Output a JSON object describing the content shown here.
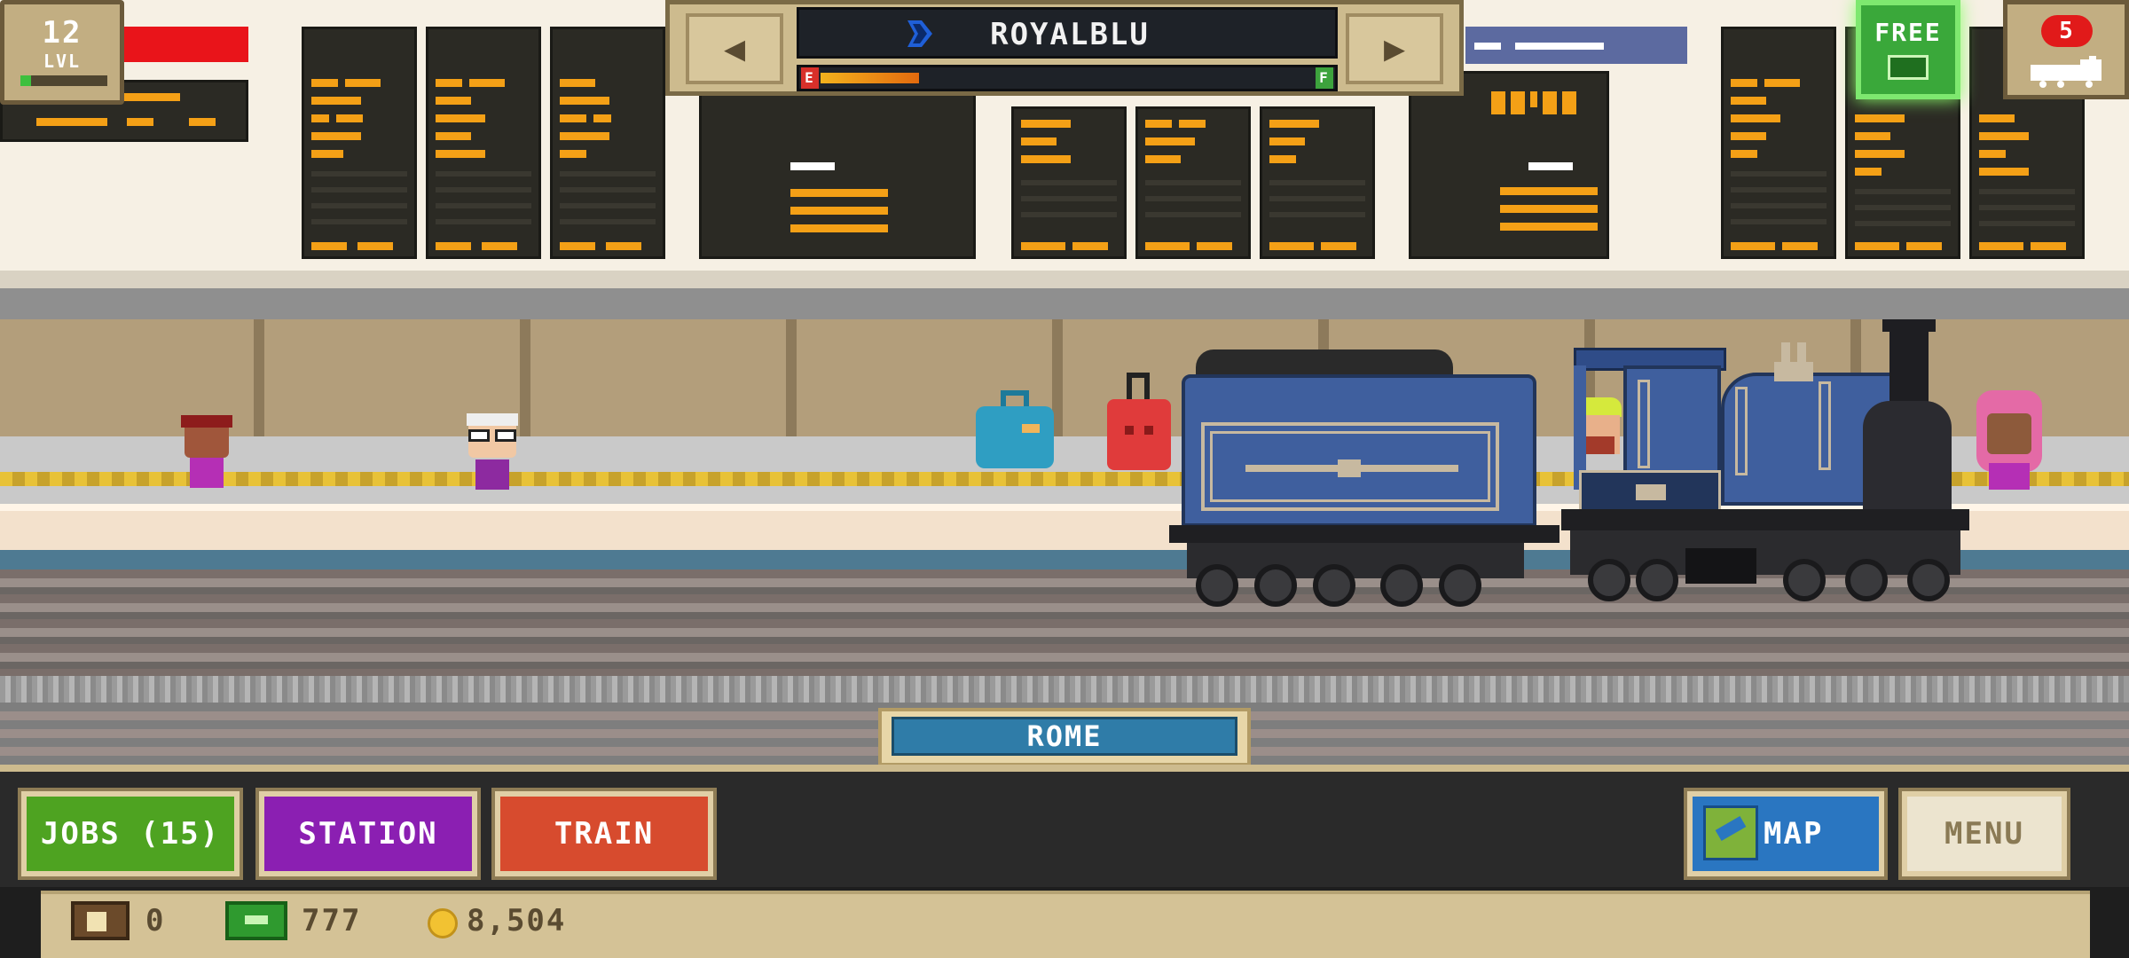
{
  "hud": {
    "level": "12",
    "level_label": "LVL",
    "level_progress": 0.12,
    "train_name": "ROYALBLU",
    "fuel_empty_label": "E",
    "fuel_full_label": "F",
    "fuel_level": 0.2,
    "free_label": "FREE",
    "notification_count": "5"
  },
  "location": {
    "station_name": "ROME"
  },
  "bottom_bar": {
    "jobs_label": "JOBS (15)",
    "station_label": "STATION",
    "train_label": "TRAIN",
    "map_label": "MAP",
    "menu_label": "MENU"
  },
  "currency": {
    "crates": "0",
    "cash": "777",
    "coins": "8,504"
  },
  "colors": {
    "jobs": "#4ea321",
    "station": "#8b1fb2",
    "train": "#d74b2e",
    "map": "#2a76c1",
    "locomotive": "#3f5f9e"
  },
  "icons": [
    "prev-arrow-icon",
    "next-arrow-icon",
    "brand-icon",
    "ticket-icon",
    "train-icon",
    "map-icon",
    "crate-icon",
    "cash-icon",
    "coin-icon"
  ]
}
